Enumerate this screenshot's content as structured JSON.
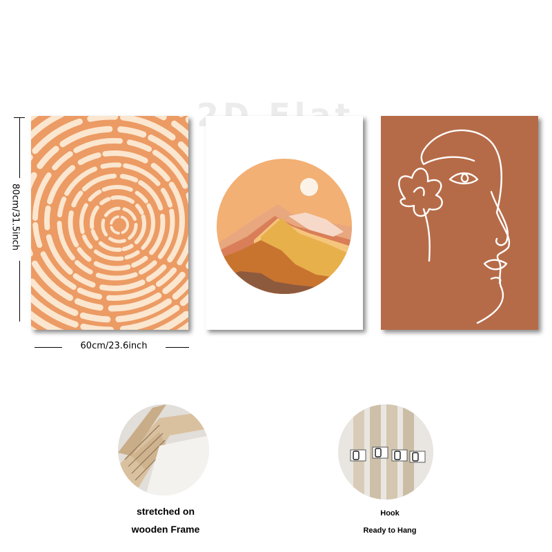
{
  "watermark": "2D Flat",
  "dimensions": {
    "height_label": "80cm/31.5inch",
    "width_label": "60cm/23.6inch"
  },
  "panels": [
    {
      "name": "wood-ring-print",
      "background": "#EC9B64",
      "ink": "#FBE6CF"
    },
    {
      "name": "mountain-sun-print",
      "background": "#FFFFFF",
      "circle": "#F2B074"
    },
    {
      "name": "line-face-print",
      "background": "#B66B48",
      "line": "#FFFFFF"
    }
  ],
  "features": [
    {
      "icon": "wooden-frame-photo",
      "caption_line1": "stretched on",
      "caption_line2": "wooden Frame"
    },
    {
      "icon": "hook-photo",
      "caption_line1": "Hook",
      "caption_line2": "Ready to Hang"
    }
  ]
}
